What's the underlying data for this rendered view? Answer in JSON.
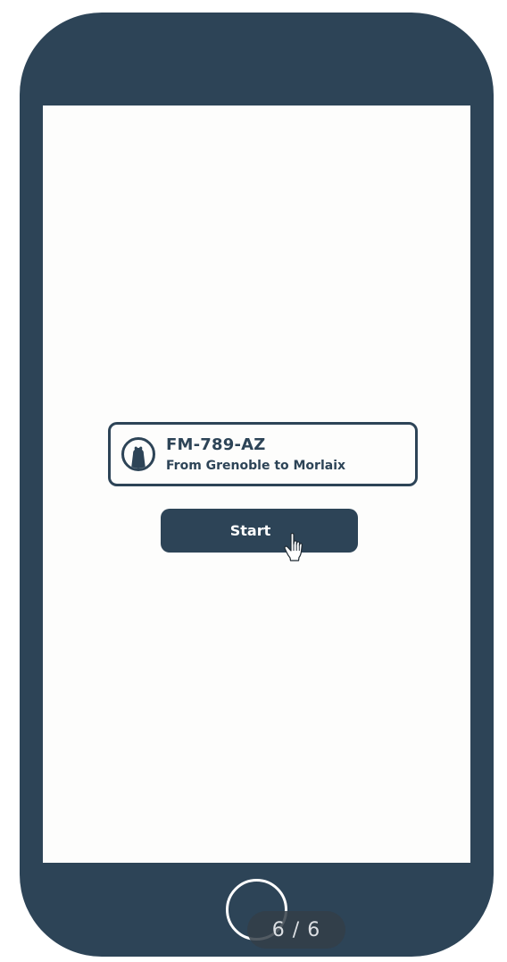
{
  "theme": {
    "brand_color": "#2d4457",
    "screen_color": "#fdfdfc",
    "button_text_color": "#ffffff"
  },
  "vehicle": {
    "icon": "bear-icon",
    "plate": "FM-789-AZ",
    "route": "From Grenoble to Morlaix"
  },
  "actions": {
    "start_label": "Start"
  },
  "pager": {
    "label": "6 / 6"
  }
}
